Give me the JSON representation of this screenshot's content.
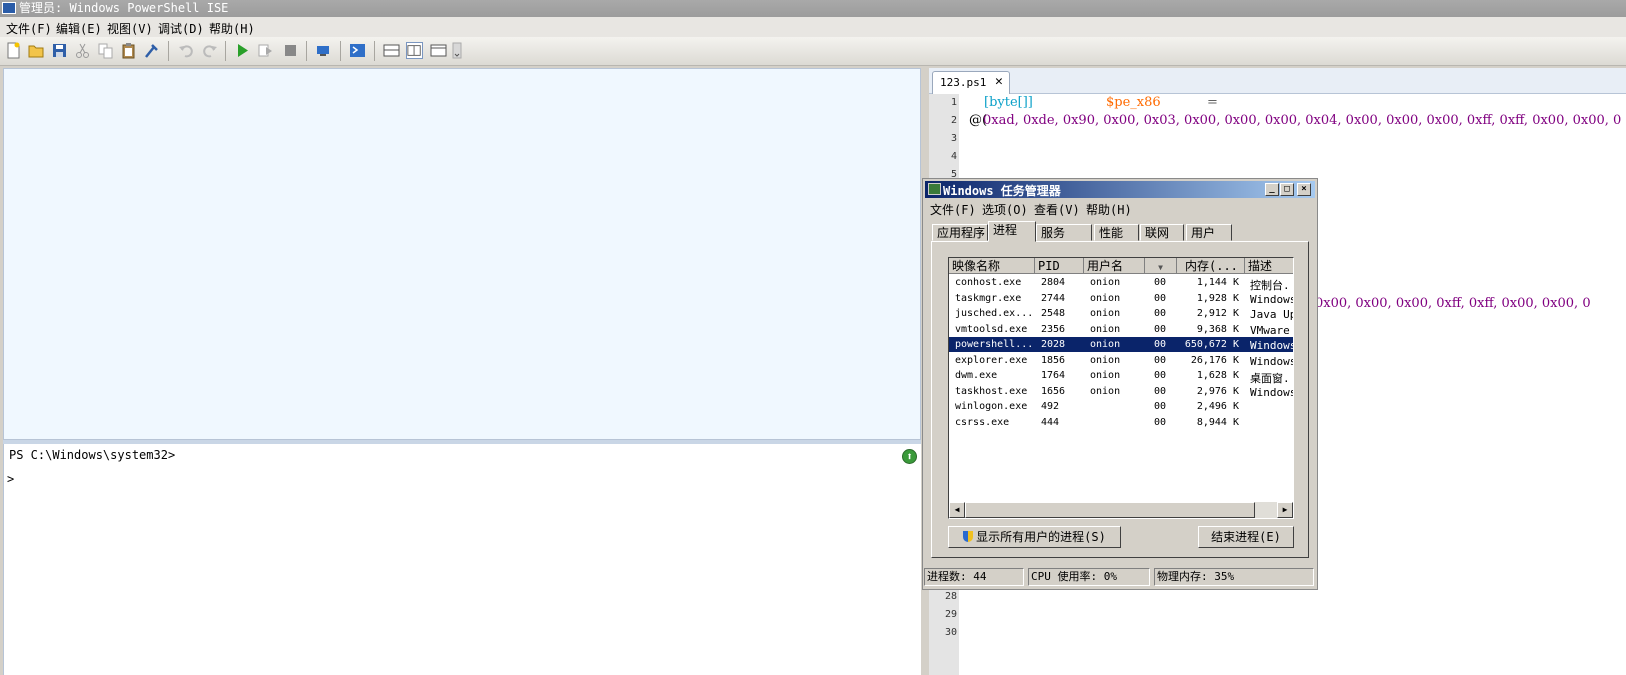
{
  "ise": {
    "title": "管理员: Windows PowerShell ISE",
    "menu": [
      "文件(F)",
      "编辑(E)",
      "视图(V)",
      "调试(D)",
      "帮助(H)"
    ],
    "console_prompt": "PS C:\\Windows\\system32>",
    "console_input": ">",
    "up_glyph": "⬆"
  },
  "script": {
    "tab_label": "123.ps1",
    "tab_close": "✕",
    "line_numbers": [
      "1",
      "2",
      "3",
      "4",
      "5",
      "28",
      "29",
      "30"
    ],
    "line1": {
      "type": "[byte[]]",
      "var": "$pe_x86",
      "op": "="
    },
    "line2": {
      "start": "@(",
      "values": "0xad, 0xde, 0x90, 0x00, 0x03, 0x00, 0x00, 0x00, 0x04, 0x00, 0x00, 0x00, 0xff, 0xff, 0x00, 0x00, 0"
    },
    "line_partial": "0x00, 0x00, 0x00, 0xff, 0xff, 0x00, 0x00, 0"
  },
  "taskmgr": {
    "title": "Windows 任务管理器",
    "menu": [
      "文件(F)",
      "选项(O)",
      "查看(V)",
      "帮助(H)"
    ],
    "tabs": [
      "应用程序",
      "进程",
      "服务",
      "性能",
      "联网",
      "用户"
    ],
    "active_tab": "进程",
    "columns": [
      "映像名称",
      "PID",
      "用户名",
      "",
      "内存(...",
      "描述"
    ],
    "processes": [
      {
        "name": "conhost.exe",
        "pid": "2804",
        "user": "onion",
        "session": "00",
        "mem": "1,144 K",
        "desc": "控制台."
      },
      {
        "name": "taskmgr.exe",
        "pid": "2744",
        "user": "onion",
        "session": "00",
        "mem": "1,928 K",
        "desc": "Windows"
      },
      {
        "name": "jusched.ex...",
        "pid": "2548",
        "user": "onion",
        "session": "00",
        "mem": "2,912 K",
        "desc": "Java Up"
      },
      {
        "name": "vmtoolsd.exe",
        "pid": "2356",
        "user": "onion",
        "session": "00",
        "mem": "9,368 K",
        "desc": "VMware"
      },
      {
        "name": "powershell...",
        "pid": "2028",
        "user": "onion",
        "session": "00",
        "mem": "650,672 K",
        "desc": "Windows",
        "selected": true
      },
      {
        "name": "explorer.exe",
        "pid": "1856",
        "user": "onion",
        "session": "00",
        "mem": "26,176 K",
        "desc": "Windows"
      },
      {
        "name": "dwm.exe",
        "pid": "1764",
        "user": "onion",
        "session": "00",
        "mem": "1,628 K",
        "desc": "桌面窗."
      },
      {
        "name": "taskhost.exe",
        "pid": "1656",
        "user": "onion",
        "session": "00",
        "mem": "2,976 K",
        "desc": "Windows"
      },
      {
        "name": "winlogon.exe",
        "pid": "492",
        "user": "",
        "session": "00",
        "mem": "2,496 K",
        "desc": ""
      },
      {
        "name": "csrss.exe",
        "pid": "444",
        "user": "",
        "session": "00",
        "mem": "8,944 K",
        "desc": ""
      }
    ],
    "show_all_button": "显示所有用户的进程(S)",
    "end_process_button": "结束进程(E)",
    "status": {
      "processes": "进程数: 44",
      "cpu": "CPU 使用率: 0%",
      "memory": "物理内存: 35%"
    }
  },
  "colors": {
    "type": "#0aa0c8",
    "variable": "#ff6a00",
    "operator": "#606060",
    "number": "#800080",
    "selection": "#0a246a"
  }
}
